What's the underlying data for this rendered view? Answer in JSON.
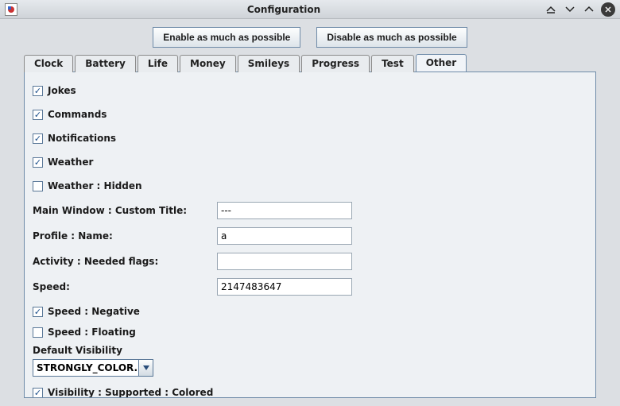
{
  "window": {
    "title": "Configuration"
  },
  "toolbar": {
    "enable_label": "Enable as much as possible",
    "disable_label": "Disable as much as possible"
  },
  "tabs": {
    "items": [
      "Clock",
      "Battery",
      "Life",
      "Money",
      "Smileys",
      "Progress",
      "Test",
      "Other"
    ],
    "active_index": 7
  },
  "other": {
    "checks": {
      "jokes": {
        "label": "Jokes",
        "checked": true
      },
      "commands": {
        "label": "Commands",
        "checked": true
      },
      "notifications": {
        "label": "Notifications",
        "checked": true
      },
      "weather": {
        "label": "Weather",
        "checked": true
      },
      "weather_hidden": {
        "label": "Weather : Hidden",
        "checked": false
      },
      "speed_negative": {
        "label": "Speed : Negative",
        "checked": true
      },
      "speed_floating": {
        "label": "Speed : Floating",
        "checked": false
      },
      "visibility_colored": {
        "label": "Visibility : Supported : Colored",
        "checked": true
      }
    },
    "fields": {
      "custom_title": {
        "label": "Main Window : Custom Title:",
        "value": "---"
      },
      "profile_name": {
        "label": "Profile : Name:",
        "value": "a"
      },
      "needed_flags": {
        "label": "Activity : Needed flags:",
        "value": ""
      },
      "speed": {
        "label": "Speed:",
        "value": "2147483647"
      }
    },
    "default_visibility": {
      "label": "Default Visibility",
      "value": "STRONGLY_COLOR..."
    }
  }
}
